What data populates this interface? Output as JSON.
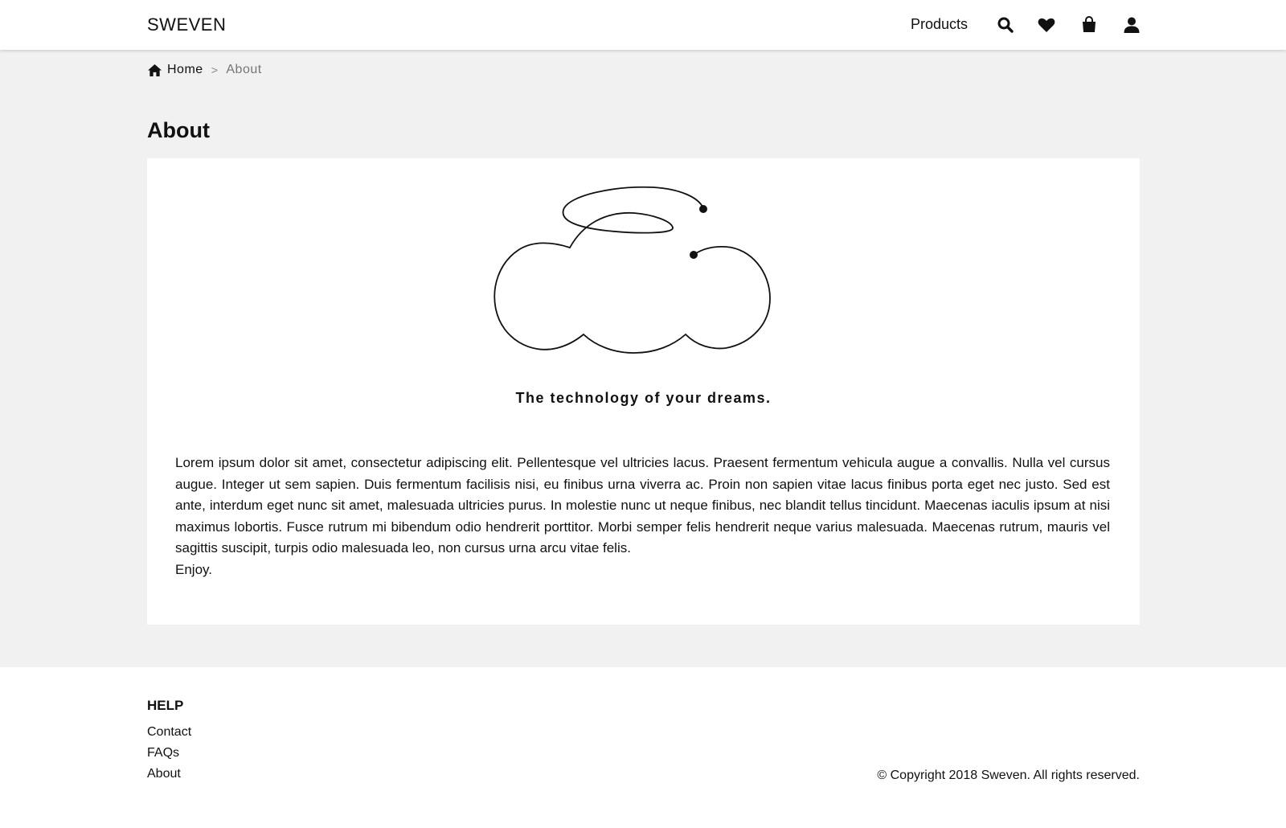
{
  "header": {
    "logo": "SWEVEN",
    "nav_products": "Products",
    "icons": [
      "search-icon",
      "heart-icon",
      "shopping-bag-icon",
      "user-icon"
    ]
  },
  "breadcrumb": {
    "home": "Home",
    "separator": ">",
    "current": "About"
  },
  "main": {
    "title": "About",
    "tagline": "The technology of your dreams.",
    "body": "Lorem ipsum dolor sit amet, consectetur adipiscing elit. Pellentesque vel ultricies lacus. Praesent fermentum vehicula augue a convallis. Nulla vel cursus augue. Integer ut sem sapien. Duis fermentum facilisis nisi, eu finibus urna viverra ac. Proin non sapien vitae lacus finibus porta eget nec justo. Sed est ante, interdum eget nunc sit amet, malesuada ultricies purus. In molestie nunc ut neque finibus, nec blandit tellus tincidunt. Maecenas iaculis ipsum at nisi maximus lobortis. Fusce rutrum mi bibendum odio hendrerit porttitor. Morbi semper felis hendrerit neque varius malesuada. Maecenas rutrum, mauris vel sagittis suscipit, turpis odio malesuada leo, non cursus urna arcu vitae felis.",
    "closing": "Enjoy."
  },
  "footer": {
    "help_title": "HELP",
    "links": [
      "Contact",
      "FAQs",
      "About"
    ],
    "copyright": "© Copyright 2018 Sweven. All rights reserved."
  },
  "colors": {
    "background": "#f1f1f1",
    "card": "#ffffff",
    "text": "#111111",
    "breadcrumb_current": "#777777"
  }
}
